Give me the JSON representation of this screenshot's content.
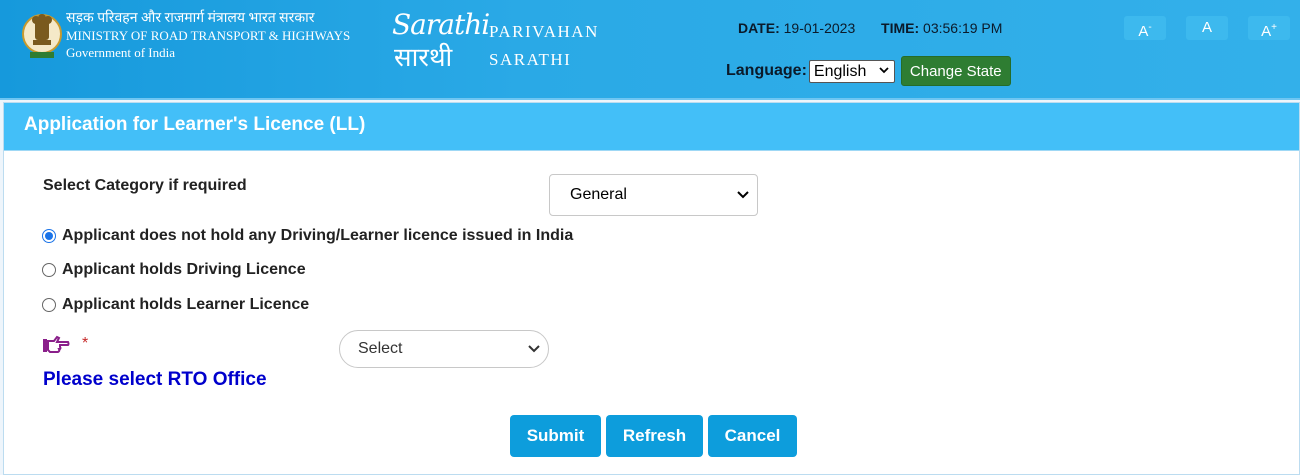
{
  "header": {
    "ministry_hindi": "सड़क परिवहन और राजमार्ग मंत्रालय भारत सरकार",
    "ministry_english": "MINISTRY OF ROAD TRANSPORT & HIGHWAYS",
    "government": "Government of India",
    "logo_script_en": "Sarathi",
    "logo_script_hi": "सारथी",
    "brand_line1": "PARIVAHAN",
    "brand_line2": "SARATHI",
    "date_label": "DATE:",
    "date_value": "19-01-2023",
    "time_label": "TIME:",
    "time_value": "03:56:19 PM",
    "font_decrease": "A",
    "font_decrease_sup": "-",
    "font_normal": "A",
    "font_increase": "A",
    "font_increase_sup": "+",
    "language_label": "Language:",
    "language_selected": "English",
    "change_state": "Change State"
  },
  "form": {
    "title": "Application for Learner's Licence (LL)",
    "category_label": "Select Category if required",
    "category_selected": "General",
    "radio_options": [
      {
        "label": "Applicant does not hold any Driving/Learner licence issued in India",
        "checked": true
      },
      {
        "label": "Applicant holds Driving Licence",
        "checked": false
      },
      {
        "label": "Applicant holds Learner Licence",
        "checked": false
      }
    ],
    "required_mark": "*",
    "rto_selected": "Select",
    "rto_message": "Please select RTO Office",
    "buttons": {
      "submit": "Submit",
      "refresh": "Refresh",
      "cancel": "Cancel"
    }
  },
  "colors": {
    "header_blue": "#1699dc",
    "title_bar": "#43bff8",
    "button_blue": "#0d9ddc",
    "change_state_green": "#2e7d32",
    "message_blue": "#0000cc",
    "hand_icon": "#8a1f8a"
  },
  "icons": [
    "national-emblem-icon",
    "pointing-hand-icon",
    "chevron-down-icon"
  ]
}
